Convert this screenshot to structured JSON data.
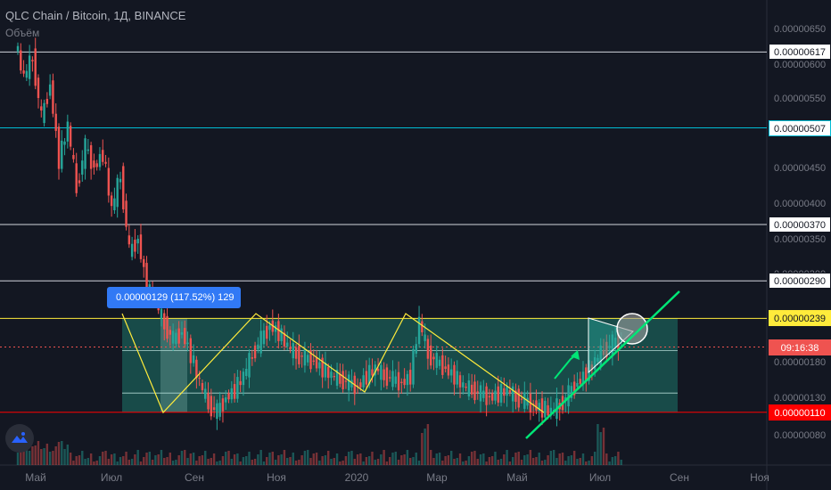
{
  "header": {
    "title": "QLC Chain / Bitcoin, 1Д, BINANCE",
    "volume_label": "Объём"
  },
  "measure_label": "0.00000129 (117.52%) 129",
  "price_labels": [
    {
      "value": "0.00000617",
      "price": 6.17e-06,
      "bg": "#ffffff",
      "fg": "#131722",
      "border": "#131722"
    },
    {
      "value": "0.00000507",
      "price": 5.07e-06,
      "bg": "#ffffff",
      "fg": "#131722",
      "border": "#00bcd4"
    },
    {
      "value": "0.00000370",
      "price": 3.7e-06,
      "bg": "#ffffff",
      "fg": "#131722",
      "border": "#131722"
    },
    {
      "value": "0.00000290",
      "price": 2.9e-06,
      "bg": "#ffffff",
      "fg": "#131722",
      "border": "#131722"
    },
    {
      "value": "0.00000239",
      "price": 2.39e-06,
      "bg": "#ffeb3b",
      "fg": "#131722",
      "border": "#ffeb3b"
    },
    {
      "value": "09:16:38",
      "price": 2e-06,
      "bg": "#ef5350",
      "fg": "#ffffff",
      "border": "#ef5350"
    },
    {
      "value": "0.00000110",
      "price": 1.1e-06,
      "bg": "#ff0000",
      "fg": "#ffffff",
      "border": "#ff0000"
    }
  ],
  "chart_data": {
    "type": "candlestick",
    "title": "QLC Chain / Bitcoin, 1Д, BINANCE",
    "y_ticks": [
      6.5e-06,
      6e-06,
      5.5e-06,
      4.5e-06,
      4e-06,
      3.5e-06,
      3e-06,
      1.8e-06,
      1.3e-06,
      8e-07
    ],
    "y_tick_labels": [
      "0.00000650",
      "0.00000600",
      "0.00000550",
      "0.00000450",
      "0.00000400",
      "0.00000350",
      "0.00000300",
      "0.00000180",
      "0.00000130",
      "0.00000080"
    ],
    "x_ticks": [
      "Май",
      "Июл",
      "Сен",
      "Ноя",
      "2020",
      "Мар",
      "Май",
      "Июл",
      "Сен",
      "Ноя"
    ],
    "horizontal_levels": [
      {
        "price": 6.17e-06,
        "color": "#d1d4dc"
      },
      {
        "price": 5.07e-06,
        "color": "#00bcd4"
      },
      {
        "price": 3.7e-06,
        "color": "#d1d4dc"
      },
      {
        "price": 2.9e-06,
        "color": "#d1d4dc"
      },
      {
        "price": 2.39e-06,
        "color": "#ffeb3b"
      },
      {
        "price": 1.1e-06,
        "color": "#ff0000"
      }
    ],
    "price_path": [
      6.3,
      5.8,
      6.1,
      5.2,
      5.7,
      4.6,
      5.1,
      4.2,
      4.8,
      4.5,
      4.7,
      3.9,
      4.4,
      3.3,
      3.5,
      2.8,
      2.6,
      2.3,
      2.1,
      2.2,
      1.9,
      1.5,
      1.2,
      1.1,
      1.3,
      1.4,
      1.6,
      1.9,
      2.1,
      2.3,
      2.2,
      2.0,
      1.9,
      1.85,
      1.8,
      1.7,
      1.6,
      1.55,
      1.5,
      1.45,
      1.6,
      1.7,
      1.6,
      1.55,
      1.5,
      1.6,
      2.35,
      1.9,
      1.8,
      1.7,
      1.6,
      1.45,
      1.4,
      1.35,
      1.3,
      1.35,
      1.4,
      1.3,
      1.25,
      1.2,
      1.15,
      1.1,
      1.2,
      1.35,
      1.5,
      1.65,
      1.8,
      1.95,
      2.05,
      2.1
    ],
    "unit_multiplier": 1e-06,
    "series": [
      {
        "name": "Объём",
        "type": "volume"
      }
    ],
    "colors": {
      "up": "#26a69a",
      "down": "#ef5350",
      "trendline": "#00e676",
      "pattern": "#ffeb3b",
      "zone": "#1b5e57"
    }
  }
}
